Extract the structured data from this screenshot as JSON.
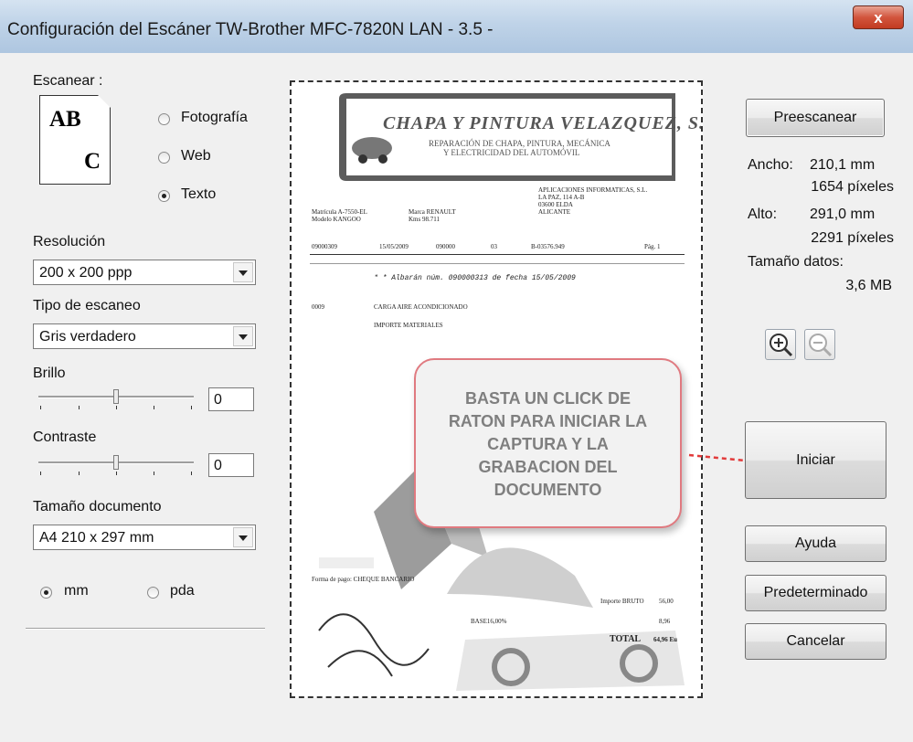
{
  "window": {
    "title": "Configuración del Escáner TW-Brother MFC-7820N LAN - 3.5 -",
    "close_label": "x"
  },
  "scan_type": {
    "label": "Escanear :",
    "icon_text_top": "AB",
    "icon_text_bottom": "C",
    "options": [
      {
        "label": "Fotografía",
        "selected": false
      },
      {
        "label": "Web",
        "selected": false
      },
      {
        "label": "Texto",
        "selected": true
      }
    ]
  },
  "resolution": {
    "label": "Resolución",
    "value": "200 x 200 ppp"
  },
  "scan_mode": {
    "label": "Tipo de escaneo",
    "value": "Gris verdadero"
  },
  "brightness": {
    "label": "Brillo",
    "value": "0",
    "slider_fraction": 0.5
  },
  "contrast": {
    "label": "Contraste",
    "value": "0",
    "slider_fraction": 0.5
  },
  "document_size": {
    "label": "Tamaño documento",
    "value": "A4 210 x 297 mm"
  },
  "units": [
    {
      "label": "mm",
      "selected": true
    },
    {
      "label": "pda",
      "selected": false
    }
  ],
  "buttons": {
    "prescan": "Preescanear",
    "start": "Iniciar",
    "help": "Ayuda",
    "default": "Predeterminado",
    "cancel": "Cancelar"
  },
  "info": {
    "width_label": "Ancho:",
    "width_mm": "210,1 mm",
    "width_px": "1654 píxeles",
    "height_label": "Alto:",
    "height_mm": "291,0 mm",
    "height_px": "2291 píxeles",
    "data_size_label": "Tamaño datos:",
    "data_size": "3,6 MB"
  },
  "callout": {
    "lines": [
      "BASTA UN CLICK DE",
      "RATON PARA INICIAR LA",
      "CAPTURA Y LA",
      "GRABACION DEL",
      "DOCUMENTO"
    ],
    "border_color": "#e07a80",
    "arrow_color": "#e23b3b"
  },
  "document": {
    "company": "CHAPA Y PINTURA VELAZQUEZ, S.L.",
    "subtitle1": "REPARACIÓN DE CHAPA, PINTURA, MECÁNICA",
    "subtitle2": "Y ELECTRICIDAD DEL AUTOMÓVIL",
    "customer": "APLICACIONES INFORMATICAS, S.L.",
    "customer_addr1": "LA PAZ, 114 A-B",
    "customer_addr2": "03600 ELDA",
    "customer_addr3": "ALICANTE",
    "plate": "Matrícula A-7550-EL",
    "model": "Modelo KANGOO",
    "make": "Marca RENAULT",
    "km": "Kms 98.711",
    "invoice_no": "09000309",
    "invoice_date": "15/05/2009",
    "client_no": "090000",
    "zone": "03",
    "cif": "B-03576.949",
    "page": "Pág. 1",
    "albaran": "* * Albarán núm. 090000313 de fecha 15/05/2009",
    "line_item": "CARGA AIRE ACONDICIONADO",
    "line_code": "0009",
    "materials": "IMPORTE MATERIALES",
    "payment": "Forma de pago: CHEQUE BANCARIO",
    "total_label": "TOTAL",
    "total": "64,96 Eu",
    "bruto": "Importe BRUTO",
    "bruto_val": "56,00",
    "base": "BASE16,00%",
    "iva": "8,96"
  }
}
